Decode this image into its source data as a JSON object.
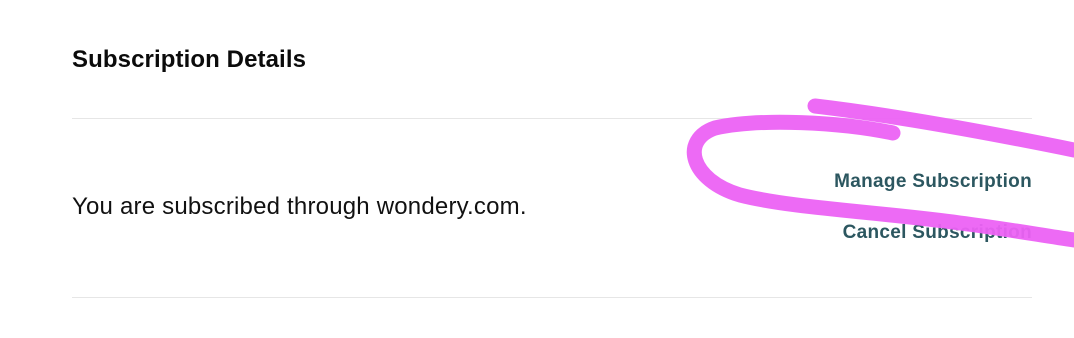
{
  "subscription": {
    "title": "Subscription Details",
    "status_text": "You are subscribed through wondery.com.",
    "actions": {
      "manage_label": "Manage Subscription",
      "cancel_label": "Cancel Subscription"
    }
  },
  "annotation": {
    "scribble_color": "#ec62f4"
  }
}
